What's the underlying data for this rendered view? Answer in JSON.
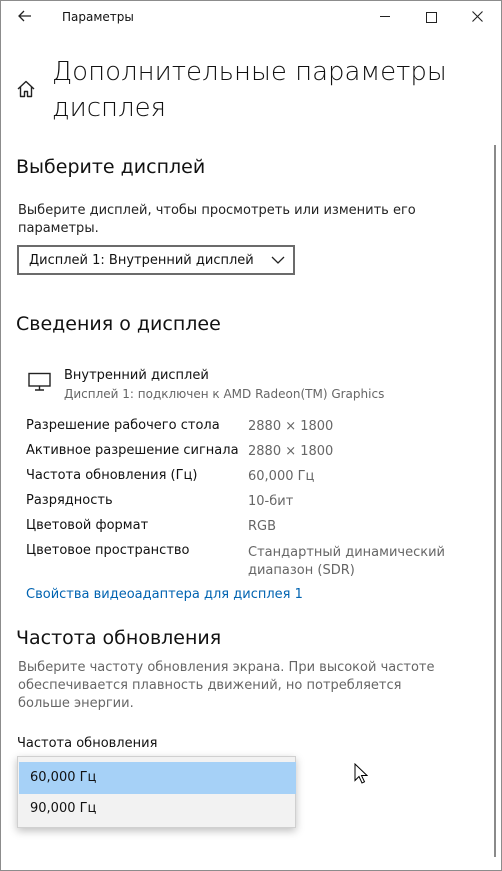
{
  "window": {
    "title": "Параметры",
    "back_icon": "arrow-left-icon"
  },
  "page": {
    "title": "Дополнительные параметры дисплея"
  },
  "select_display": {
    "heading": "Выберите дисплей",
    "description": "Выберите дисплей, чтобы просмотреть или изменить его параметры.",
    "selected": "Дисплей 1: Внутренний дисплей"
  },
  "display_info": {
    "heading": "Сведения о дисплее",
    "name": "Внутренний дисплей",
    "connection": "Дисплей 1: подключен к AMD Radeon(TM) Graphics",
    "rows": [
      {
        "label": "Разрешение рабочего стола",
        "value": "2880 × 1800"
      },
      {
        "label": "Активное разрешение сигнала",
        "value": "2880 × 1800"
      },
      {
        "label": "Частота обновления (Гц)",
        "value": "60,000 Гц"
      },
      {
        "label": "Разрядность",
        "value": "10-бит"
      },
      {
        "label": "Цветовой формат",
        "value": "RGB"
      },
      {
        "label": "Цветовое пространство",
        "value": "Стандартный динамический диапазон (SDR)"
      }
    ],
    "adapter_link": "Свойства видеоадаптера для дисплея 1"
  },
  "refresh_rate": {
    "heading": "Частота обновления",
    "description": "Выберите частоту обновления экрана. При высокой частоте обеспечивается плавность движений, но потребляется больше энергии.",
    "field_label": "Частота обновления",
    "options": [
      "60,000 Гц",
      "90,000 Гц"
    ],
    "selected": "60,000 Гц"
  },
  "colors": {
    "accent": "#0063b1",
    "selected_option": "#a6d1f7"
  }
}
